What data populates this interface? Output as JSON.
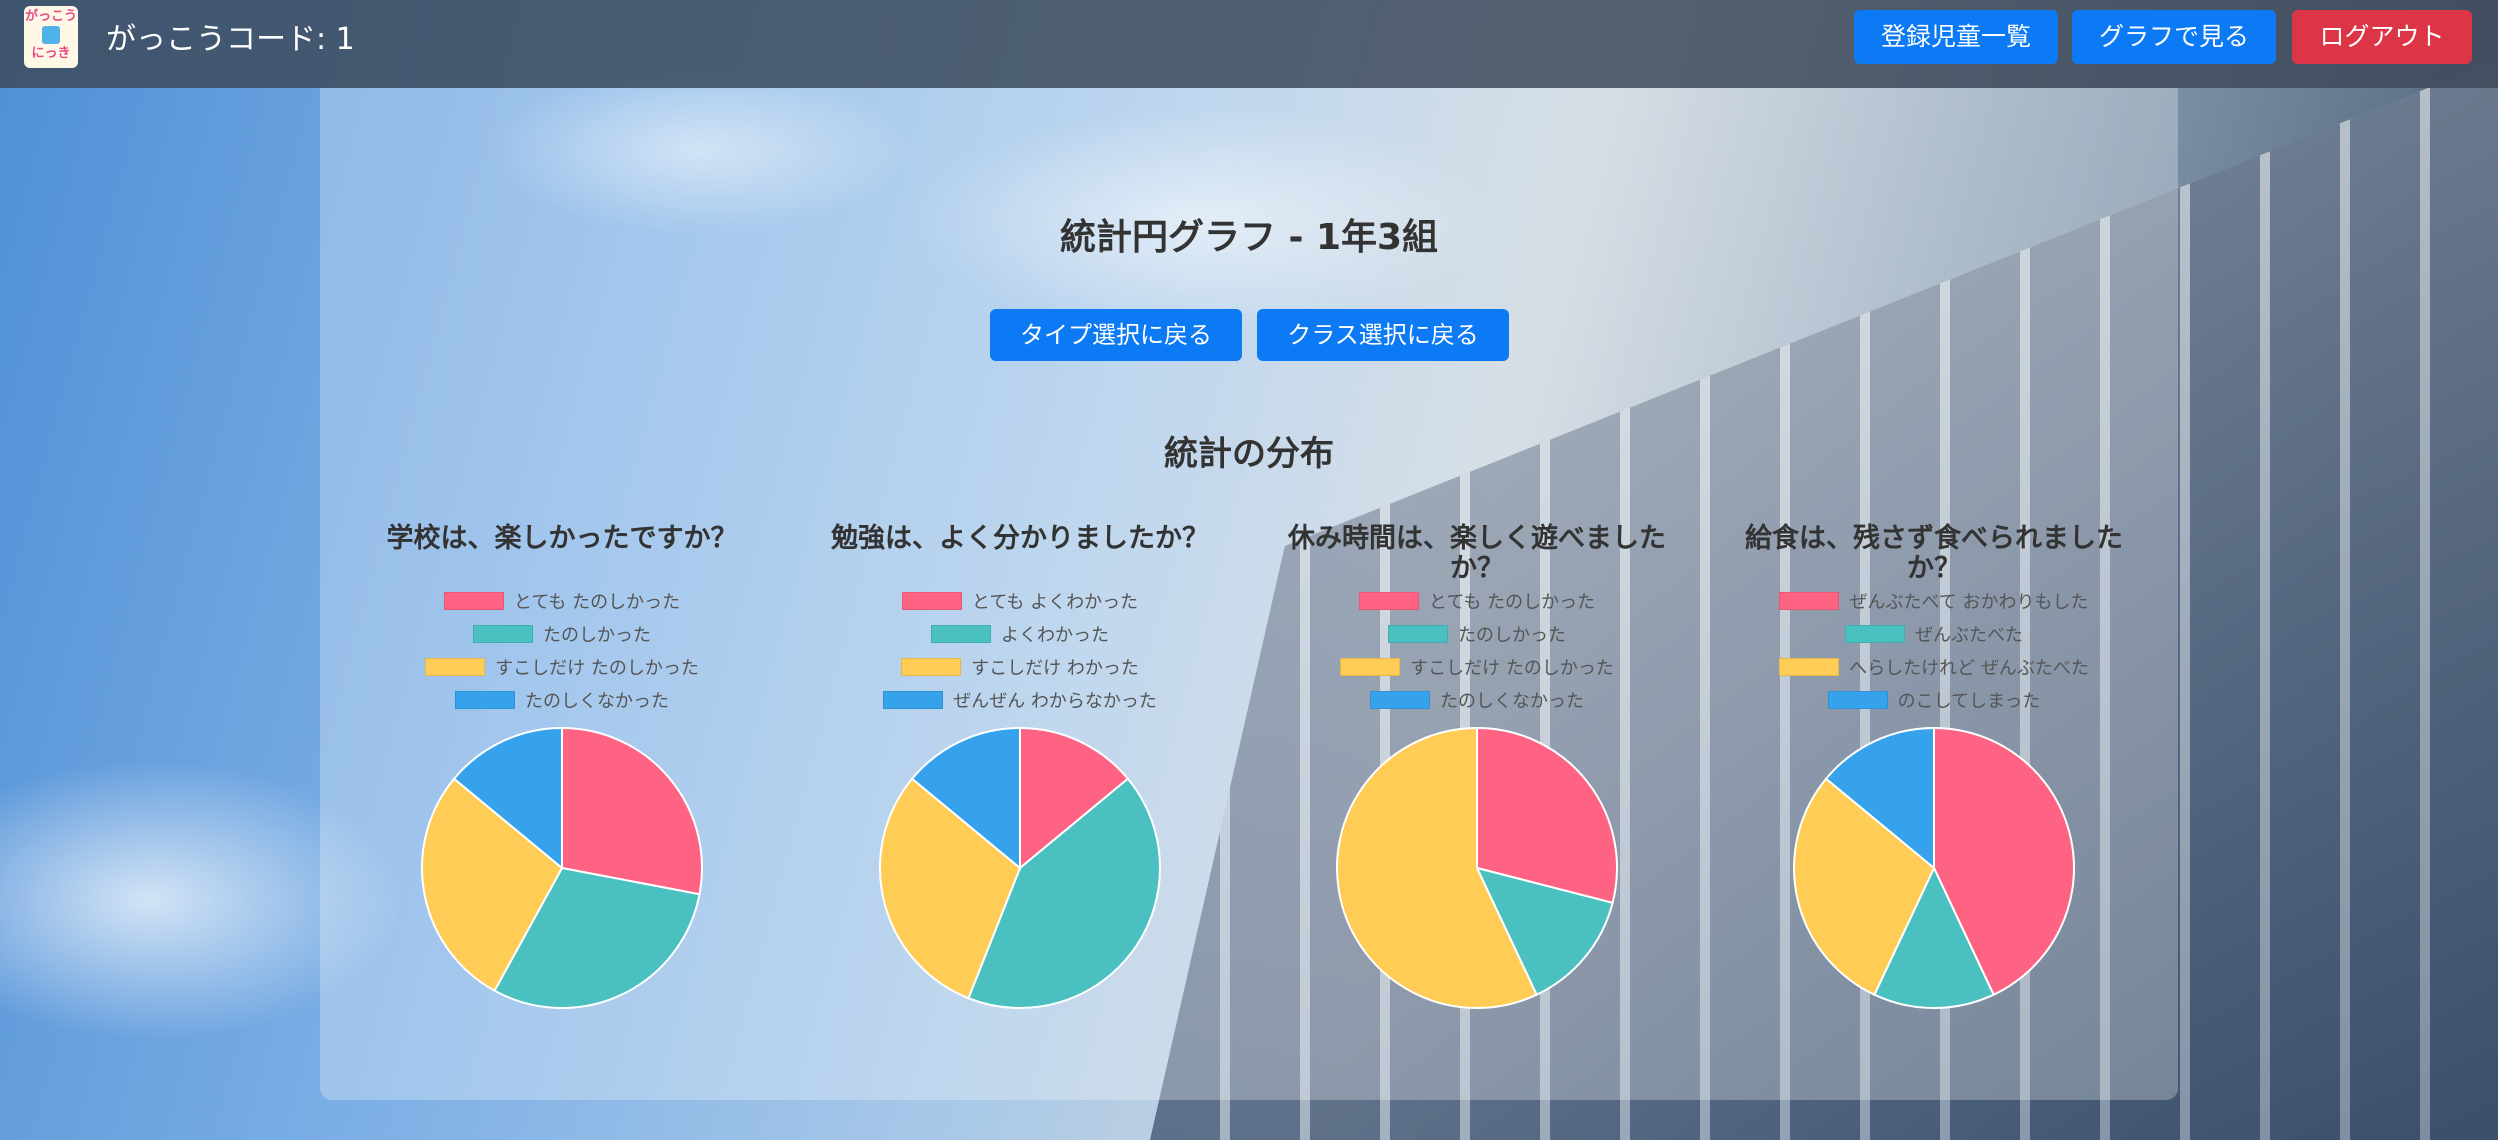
{
  "header": {
    "logo_text": "がっこうにっき",
    "school_code": "がっこうコード: 1",
    "nav": [
      {
        "label": "登録児童一覧",
        "color": "#0d7af5"
      },
      {
        "label": "グラフで見る",
        "color": "#0d7af5"
      },
      {
        "label": "ログアウト",
        "color": "#dc3545"
      }
    ]
  },
  "main": {
    "title": "統計円グラフ - 1年3組",
    "back_type_label": "タイプ選択に戻る",
    "back_class_label": "クラス選択に戻る",
    "subtitle": "統計の分布"
  },
  "colors": [
    "#ff6384",
    "#4bc0c0",
    "#ffcd56",
    "#36a2eb"
  ],
  "chart_data": [
    {
      "type": "pie",
      "title": "学校は、楽しかったですか？",
      "labels": [
        "とても たのしかった",
        "たのしかった",
        "すこしだけ たのしかった",
        "たのしくなかった"
      ],
      "values": [
        28,
        30,
        28,
        14
      ]
    },
    {
      "type": "pie",
      "title": "勉強は、よく分かりましたか？",
      "labels": [
        "とても よくわかった",
        "よくわかった",
        "すこしだけ わかった",
        "ぜんぜん わからなかった"
      ],
      "values": [
        14,
        42,
        30,
        14
      ]
    },
    {
      "type": "pie",
      "title": "休み時間は、楽しく遊べましたか？",
      "labels": [
        "とても たのしかった",
        "たのしかった",
        "すこしだけ たのしかった",
        "たのしくなかった"
      ],
      "values": [
        29,
        14,
        57,
        0
      ]
    },
    {
      "type": "pie",
      "title": "給食は、残さず食べられましたか？",
      "labels": [
        "ぜんぶたべて おかわりもした",
        "ぜんぶたべた",
        "へらしたけれど ぜんぶたべた",
        "のこしてしまった"
      ],
      "values": [
        43,
        14,
        29,
        14
      ]
    }
  ]
}
